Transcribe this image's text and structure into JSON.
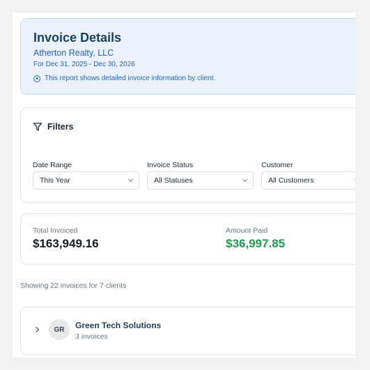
{
  "report": {
    "title": "Invoice Details",
    "company": "Atherton Realty, LLC",
    "period": "For Dec 31, 2025 - Dec 30, 2026",
    "info_text": "This report shows detailed invoice information by client."
  },
  "filters": {
    "heading": "Filters",
    "date_range": {
      "label": "Date Range",
      "value": "This Year"
    },
    "invoice_status": {
      "label": "Invoice Status",
      "value": "All Statuses"
    },
    "customer": {
      "label": "Customer",
      "value": "All Customers"
    }
  },
  "totals": {
    "total_invoiced": {
      "label": "Total Invoiced",
      "value": "$163,949.16"
    },
    "amount_paid": {
      "label": "Amount Paid",
      "value": "$36,997.85"
    }
  },
  "summary": "Showing 22 invoices for 7 clients",
  "clients": [
    {
      "initials": "GR",
      "name": "Green Tech Solutions",
      "count": "3 invoices"
    }
  ],
  "colors": {
    "accent": "#2c63b6",
    "header_bg": "#eaf2fd",
    "paid_green": "#1f9a4a",
    "title_navy": "#1c3f5e"
  }
}
